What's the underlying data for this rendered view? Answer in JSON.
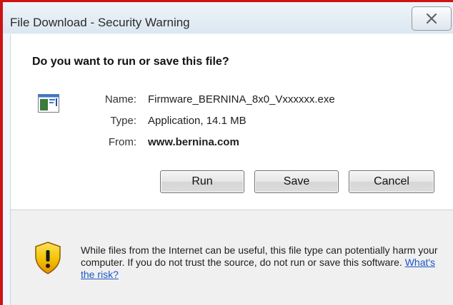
{
  "window": {
    "title": "File Download - Security Warning",
    "close_icon": "close-x-icon"
  },
  "prompt": {
    "heading": "Do you want to run or save this file?"
  },
  "file": {
    "icon": "application-window-icon",
    "name_label": "Name:",
    "name_value": "Firmware_BERNINA_8x0_Vxxxxxx.exe",
    "type_label": "Type:",
    "type_value": "Application, 14.1 MB",
    "from_label": "From:",
    "from_value": "www.bernina.com"
  },
  "buttons": {
    "run": "Run",
    "save": "Save",
    "cancel": "Cancel"
  },
  "warning": {
    "icon": "security-shield-icon",
    "text": "While files from the Internet can be useful, this file type can potentially harm your computer. If you do not trust the source, do not run or save this software. ",
    "link": "What's the risk?"
  },
  "colors": {
    "frame_border": "#cc1414",
    "link": "#1a56c4",
    "shield_yellow": "#f2c200",
    "shield_orange": "#e58a00"
  }
}
